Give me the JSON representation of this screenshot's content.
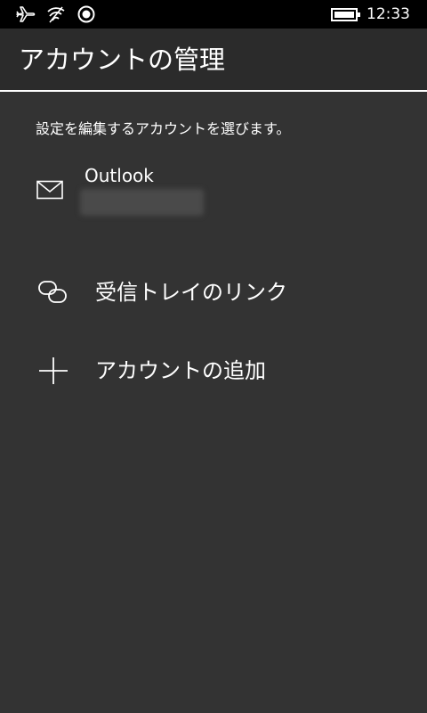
{
  "status_bar": {
    "time": "12:33",
    "icons": [
      "airplane-icon",
      "wifi-off-icon",
      "location-icon",
      "battery-icon"
    ]
  },
  "header": {
    "title": "アカウントの管理"
  },
  "instruction": "設定を編集するアカウントを選びます。",
  "accounts": [
    {
      "name": "Outlook",
      "icon": "mail-icon"
    }
  ],
  "actions": {
    "link_inbox": {
      "label": "受信トレイのリンク",
      "icon": "link-icon"
    },
    "add_account": {
      "label": "アカウントの追加",
      "icon": "plus-icon"
    }
  },
  "colors": {
    "background": "#333333",
    "header_background": "#2b2b2b",
    "status_bar": "#000000",
    "text": "#ffffff"
  }
}
